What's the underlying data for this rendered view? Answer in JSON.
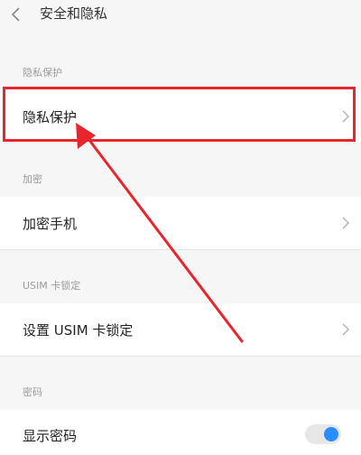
{
  "header": {
    "title": "安全和隐私",
    "back_icon": "chevron-left-icon"
  },
  "sections": {
    "privacy": {
      "label": "隐私保护",
      "item": "隐私保护"
    },
    "encryption": {
      "label": "加密",
      "item": "加密手机"
    },
    "usim": {
      "label": "USIM 卡锁定",
      "item": "设置 USIM 卡锁定"
    },
    "password": {
      "label": "密码",
      "item": "显示密码"
    }
  },
  "toggle": {
    "show_password_on": true
  },
  "colors": {
    "annotation_red": "#e8252d",
    "toggle_blue": "#2b8cff",
    "background": "#f6f6f6"
  }
}
